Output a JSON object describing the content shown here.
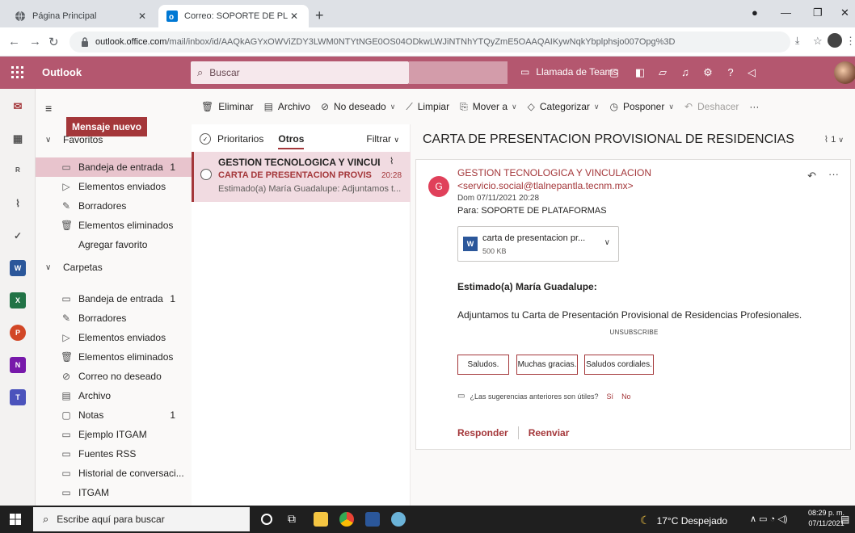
{
  "browser": {
    "tabs": [
      {
        "title": "Página Principal"
      },
      {
        "title": "Correo: SOPORTE DE PLATAFORM"
      }
    ],
    "url_domain": "outlook.office.com",
    "url_path": "/mail/inbox/id/AAQkAGYxOWViZDY3LWM0NTYtNGE0OS04ODkwLWJiNTNhYTQyZmE5OAAQAIKywNqkYbplphsjo007Opg%3D"
  },
  "header": {
    "app_name": "Outlook",
    "search_placeholder": "Buscar",
    "teams_label": "Llamada de Teams",
    "accent": "#b4576f"
  },
  "folders": {
    "new_mail": "Mensaje nuevo",
    "favorites_label": "Favoritos",
    "favorites": [
      {
        "label": "Bandeja de entrada",
        "count": "1",
        "icon": "inbox-icon"
      },
      {
        "label": "Elementos enviados",
        "count": "",
        "icon": "send-icon"
      },
      {
        "label": "Borradores",
        "count": "",
        "icon": "pencil-icon"
      },
      {
        "label": "Elementos eliminados",
        "count": "",
        "icon": "trash-icon"
      }
    ],
    "add_favorite": "Agregar favorito",
    "folders_label": "Carpetas",
    "items": [
      {
        "label": "Bandeja de entrada",
        "count": "1"
      },
      {
        "label": "Borradores",
        "count": ""
      },
      {
        "label": "Elementos enviados",
        "count": ""
      },
      {
        "label": "Elementos eliminados",
        "count": ""
      },
      {
        "label": "Correo no deseado",
        "count": ""
      },
      {
        "label": "Archivo",
        "count": ""
      },
      {
        "label": "Notas",
        "count": "1"
      },
      {
        "label": "Ejemplo ITGAM",
        "count": ""
      },
      {
        "label": "Fuentes RSS",
        "count": ""
      },
      {
        "label": "Historial de conversaci...",
        "count": ""
      },
      {
        "label": "ITGAM",
        "count": ""
      }
    ]
  },
  "toolbar": {
    "delete": "Eliminar",
    "archive": "Archivo",
    "junk": "No deseado",
    "sweep": "Limpiar",
    "move": "Mover a",
    "categorize": "Categorizar",
    "snooze": "Posponer",
    "undo": "Deshacer"
  },
  "list": {
    "focused": "Prioritarios",
    "other": "Otros",
    "filter": "Filtrar",
    "message": {
      "from": "GESTION TECNOLOGICA Y VINCULAC...",
      "subject": "CARTA DE PRESENTACION PROVISIO...",
      "time": "20:28",
      "preview": "Estimado(a) María Guadalupe: Adjuntamos t..."
    }
  },
  "reading": {
    "subject": "CARTA DE PRESENTACION PROVISIONAL DE RESIDENCIAS",
    "attach_count": "1",
    "avatar_letter": "G",
    "sender_name": "GESTION TECNOLOGICA Y VINCULACION",
    "sender_email": "<servicio.social@tlalnepantla.tecnm.mx>",
    "date": "Dom 07/11/2021 20:28",
    "to": "Para:  SOPORTE DE PLATAFORMAS",
    "attachment_name": "carta de presentacion pr...",
    "attachment_size": "500 KB",
    "greeting": "Estimado(a) María Guadalupe:",
    "body": "Adjuntamos tu Carta de Presentación Provisional de Residencias Profesionales.",
    "unsubscribe": "UNSUBSCRIBE",
    "suggestions": [
      "Saludos.",
      "Muchas gracias.",
      "Saludos cordiales."
    ],
    "feedback_q": "¿Las sugerencias anteriores son útiles?",
    "yes": "Sí",
    "no": "No",
    "reply": "Responder",
    "forward": "Reenviar"
  },
  "taskbar": {
    "search": "Escribe aquí para buscar",
    "weather": "17°C  Despejado",
    "time": "08:29 p. m.",
    "date": "07/11/2021"
  }
}
